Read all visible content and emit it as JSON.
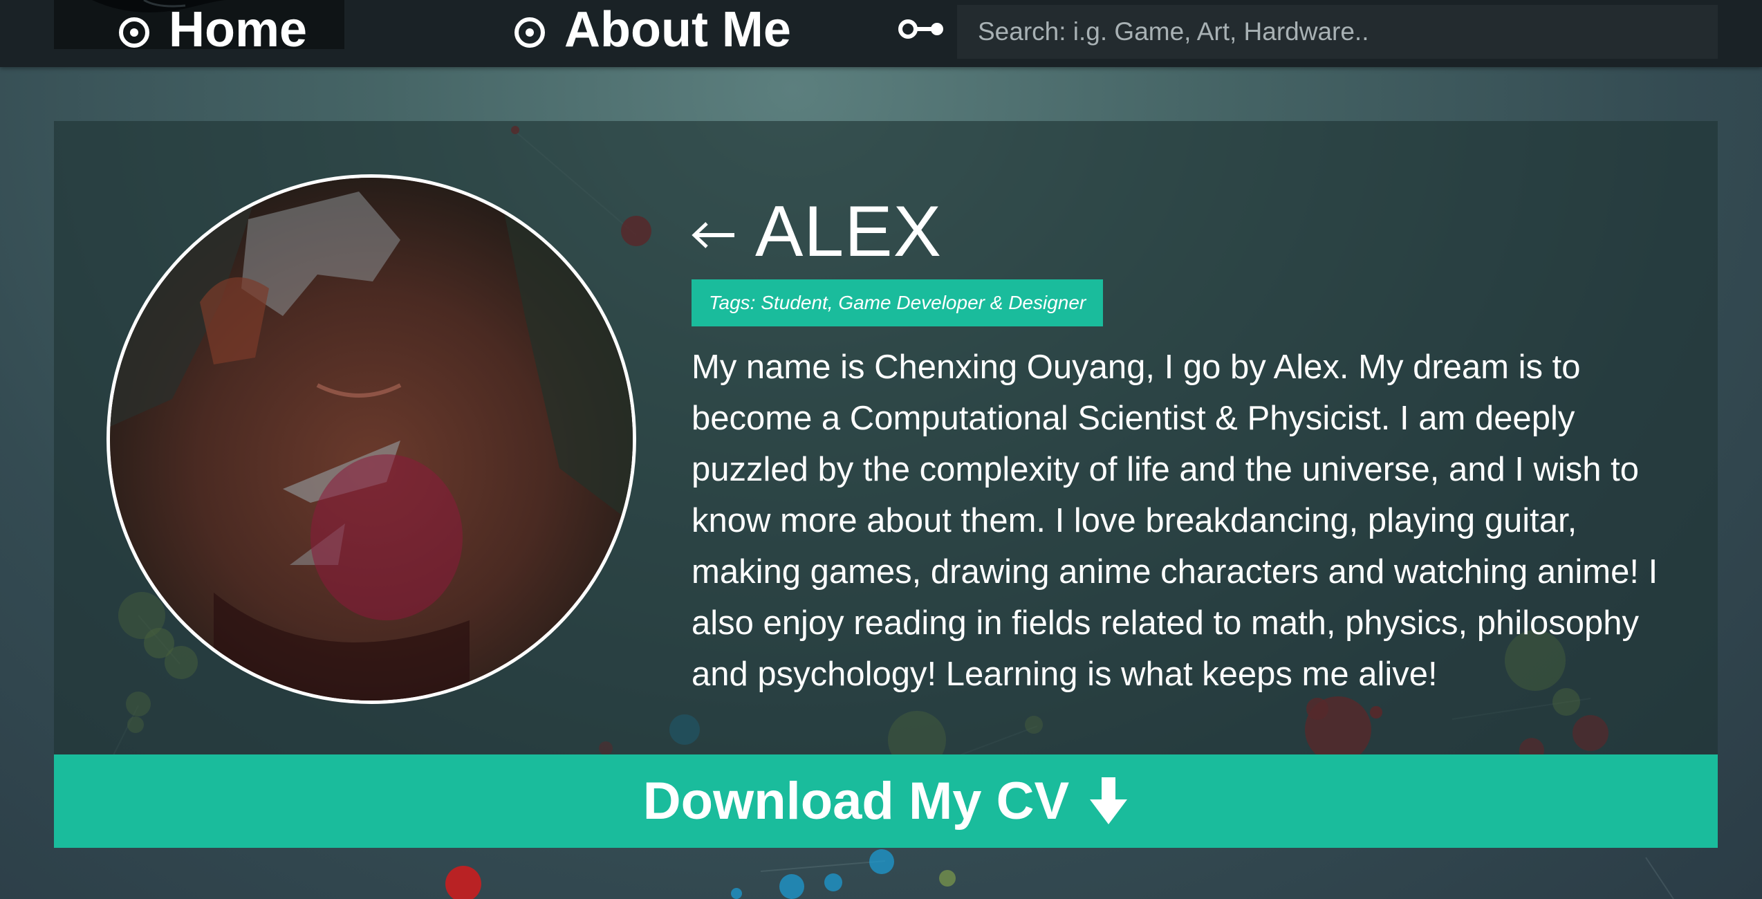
{
  "nav": {
    "home_label": "Home",
    "about_label": "About Me",
    "home_icon": "circle-dot-icon",
    "about_icon": "circle-dot-icon",
    "search_icon": "key-icon",
    "search_placeholder": "Search: i.g. Game, Art, Hardware.."
  },
  "profile": {
    "back_icon": "back-arrow-icon",
    "name": "ALEX",
    "tags": "Tags: Student, Game Developer & Designer",
    "bio": "My name is Chenxing Ouyang, I go by Alex. My dream is to become a Computational Scientist & Physicist. I am deeply puzzled by the complexity of life and the universe, and I wish to know more about them. I love breakdancing, playing guitar, making games, drawing anime characters and watching anime! I also enjoy reading in fields related to math, physics, philosophy and psychology! Learning is what keeps me alive!"
  },
  "cv": {
    "label": "Download My CV",
    "icon": "down-arrow-icon"
  },
  "colors": {
    "accent": "#1abc9c",
    "navbar": "#1a2226",
    "text": "#ffffff"
  }
}
